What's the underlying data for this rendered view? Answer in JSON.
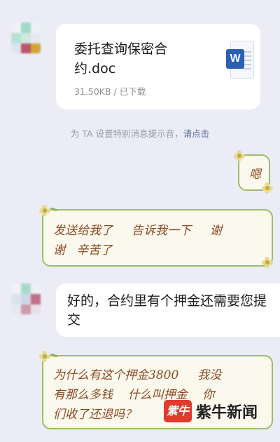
{
  "file_message": {
    "file_name": "委托查询保密合约.doc",
    "file_meta": "31.50KB / 已下载",
    "file_type_icon": "word-doc-icon",
    "icon_letter": "W"
  },
  "system_notice": {
    "text": "为 TA 设置特别消息提示音，",
    "link": "请点击"
  },
  "messages": [
    {
      "text": "嗯"
    },
    {
      "line1": "发送给我了     告诉我一下     谢",
      "line2": "谢   辛苦了"
    },
    {
      "text": "好的，合约里有个押金还需要您提交"
    },
    {
      "line1": "为什么有这个押金3800     我没",
      "line2": "有那么多钱    什么叫押金    你",
      "line3": "们收了还退吗？"
    }
  ],
  "watermark": {
    "logo_text": "紫牛",
    "text": "紫牛新闻"
  }
}
